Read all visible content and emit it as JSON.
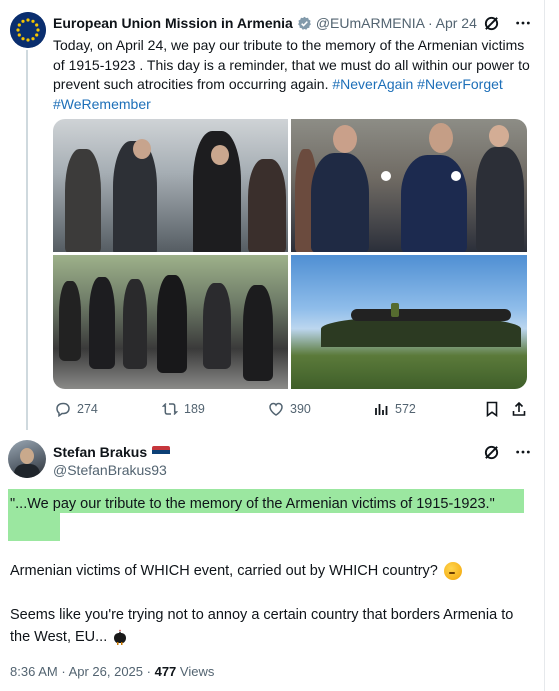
{
  "tweet1": {
    "author_name": "European Union Mission in Armenia",
    "handle": "@EUmARMENIA",
    "date": "Apr 24",
    "text": "Today, on April 24, we pay our tribute to the memory of the Armenian victims of 1915-1923 . This day is a reminder, that we must do all within our power to prevent such atrocities from occurring again.",
    "hashtags": "#NeverAgain #NeverForget #WeRemember",
    "media_count": 4,
    "stats": {
      "replies": "274",
      "reposts": "189",
      "likes": "390",
      "views": "572"
    }
  },
  "tweet2": {
    "author_name": "Stefan Brakus",
    "handle": "@StefanBrakus93",
    "quote": "\"...We pay our tribute to the memory of the Armenian victims of 1915-1923.\"",
    "paragraph1": "Armenian victims of WHICH event, carried out by WHICH country?",
    "paragraph2": "Seems like you're trying not to annoy a certain country that borders Armenia to the West, EU...",
    "time": "8:36 AM",
    "date": "Apr 26, 2025",
    "views_count": "477",
    "views_label": "Views"
  },
  "icons": {
    "verified": "verified-badge-icon",
    "grok": "grok-icon",
    "more": "more-icon",
    "reply": "reply-icon",
    "repost": "repost-icon",
    "like": "heart-icon",
    "views": "views-chart-icon",
    "bookmark": "bookmark-icon",
    "share": "share-icon"
  },
  "colors": {
    "hashtag": "#1d6fb8",
    "highlight": "#9be7a0",
    "secondary_text": "#536471"
  }
}
